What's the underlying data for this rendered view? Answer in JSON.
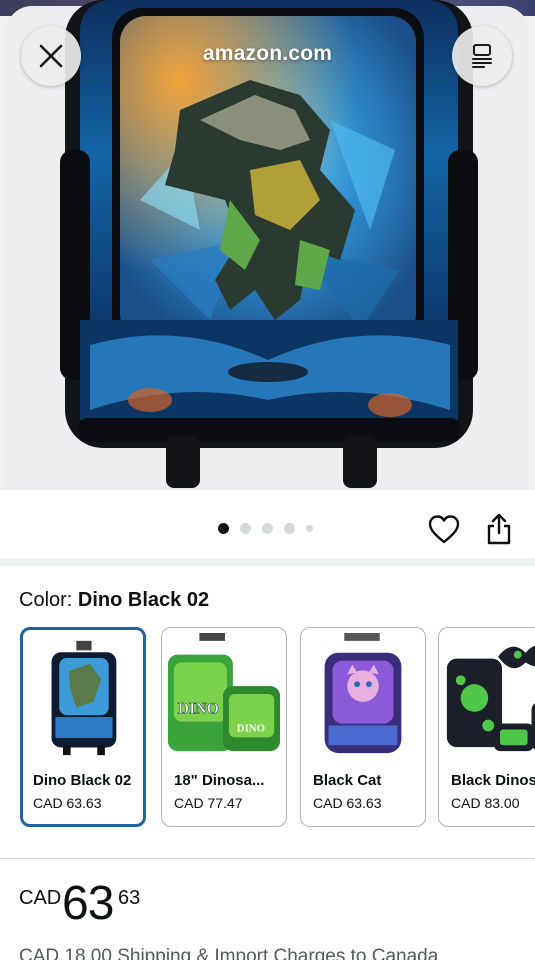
{
  "browser": {
    "url_label": "amazon.com",
    "close_icon": "close-icon",
    "reader_icon": "reader-mode-icon"
  },
  "gallery": {
    "image_subject": "dinosaur rolling backpack",
    "dots_total": 5,
    "active_index": 0
  },
  "actions": {
    "heart_icon": "heart-icon",
    "share_icon": "share-icon"
  },
  "color": {
    "label": "Color:",
    "selected": "Dino Black 02",
    "options": [
      {
        "name": "Dino Black 02",
        "price": "CAD 63.63",
        "selected": true
      },
      {
        "name": "18\" Dinosa...",
        "price": "CAD 77.47",
        "selected": false
      },
      {
        "name": "Black Cat",
        "price": "CAD 63.63",
        "selected": false
      },
      {
        "name": "Black Dinos",
        "price": "CAD 83.00",
        "selected": false
      }
    ]
  },
  "price": {
    "currency": "CAD",
    "whole": "63",
    "fraction": "63",
    "shipping_text": "CAD 18.00 Shipping & Import Charges to Canada"
  },
  "colors": {
    "accent_selected": "#2162a1",
    "text": "#0f1111",
    "muted": "#565959"
  }
}
